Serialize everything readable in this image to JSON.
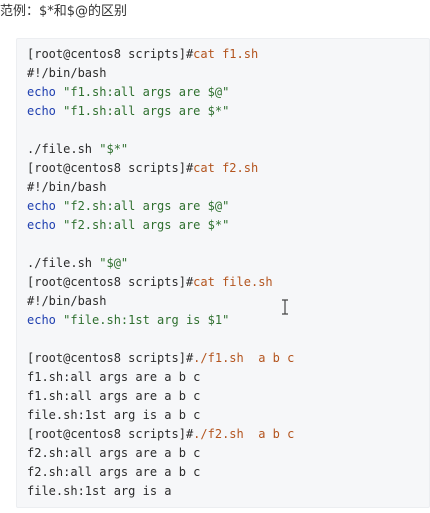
{
  "heading": "范例：$*和$@的区别",
  "code": {
    "lines": [
      [
        {
          "t": "[root@centos8 scripts]#",
          "c": "prompt"
        },
        {
          "t": "cat f1.sh",
          "c": "cmd"
        }
      ],
      [
        {
          "t": "#!/bin/bash",
          "c": "plain"
        }
      ],
      [
        {
          "t": "echo ",
          "c": "kw"
        },
        {
          "t": "\"f1.sh:all args are $@\"",
          "c": "str"
        }
      ],
      [
        {
          "t": "echo ",
          "c": "kw"
        },
        {
          "t": "\"f1.sh:all args are $*\"",
          "c": "str"
        }
      ],
      [],
      [
        {
          "t": "./file.sh ",
          "c": "plain"
        },
        {
          "t": "\"$*\"",
          "c": "str"
        }
      ],
      [
        {
          "t": "[root@centos8 scripts]#",
          "c": "prompt"
        },
        {
          "t": "cat f2.sh",
          "c": "cmd"
        }
      ],
      [
        {
          "t": "#!/bin/bash",
          "c": "plain"
        }
      ],
      [
        {
          "t": "echo ",
          "c": "kw"
        },
        {
          "t": "\"f2.sh:all args are $@\"",
          "c": "str"
        }
      ],
      [
        {
          "t": "echo ",
          "c": "kw"
        },
        {
          "t": "\"f2.sh:all args are $*\"",
          "c": "str"
        }
      ],
      [],
      [
        {
          "t": "./file.sh ",
          "c": "plain"
        },
        {
          "t": "\"$@\"",
          "c": "str"
        }
      ],
      [
        {
          "t": "[root@centos8 scripts]#",
          "c": "prompt"
        },
        {
          "t": "cat file.sh",
          "c": "cmd"
        }
      ],
      [
        {
          "t": "#!/bin/bash",
          "c": "plain"
        }
      ],
      [
        {
          "t": "echo ",
          "c": "kw"
        },
        {
          "t": "\"file.sh:1st arg is $1\"",
          "c": "str"
        }
      ],
      [],
      [
        {
          "t": "[root@centos8 scripts]#",
          "c": "prompt"
        },
        {
          "t": "./f1.sh  a b c",
          "c": "cmd"
        }
      ],
      [
        {
          "t": "f1.sh:all args are a b c",
          "c": "plain"
        }
      ],
      [
        {
          "t": "f1.sh:all args are a b c",
          "c": "plain"
        }
      ],
      [
        {
          "t": "file.sh:1st arg is a b c",
          "c": "plain"
        }
      ],
      [
        {
          "t": "[root@centos8 scripts]#",
          "c": "prompt"
        },
        {
          "t": "./f2.sh  a b c",
          "c": "cmd"
        }
      ],
      [
        {
          "t": "f2.sh:all args are a b c",
          "c": "plain"
        }
      ],
      [
        {
          "t": "f2.sh:all args are a b c",
          "c": "plain"
        }
      ],
      [
        {
          "t": "file.sh:1st arg is a",
          "c": "plain"
        }
      ]
    ]
  },
  "cursor_icon": "text-cursor-icon"
}
